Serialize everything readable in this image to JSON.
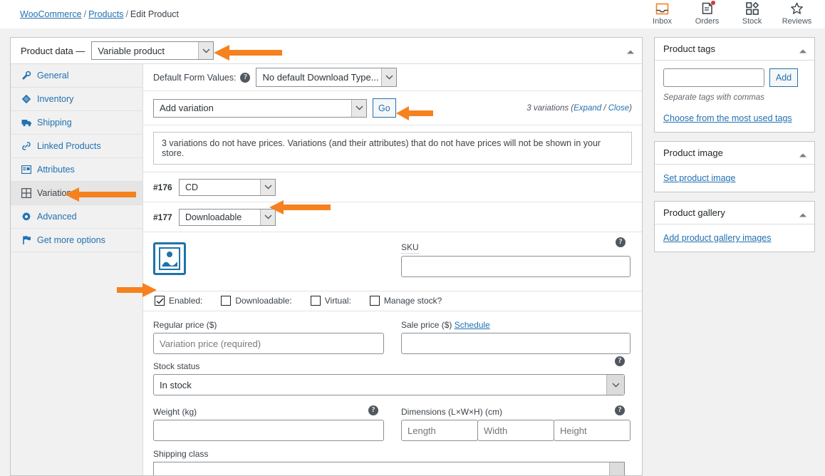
{
  "breadcrumb": {
    "root": "WooCommerce",
    "sep1": "/",
    "products": "Products",
    "sep2": "/",
    "current": "Edit Product"
  },
  "topnav": [
    {
      "label": "Inbox",
      "icon": "inbox-icon",
      "badge": false
    },
    {
      "label": "Orders",
      "icon": "orders-icon",
      "badge": true
    },
    {
      "label": "Stock",
      "icon": "stock-icon",
      "badge": false
    },
    {
      "label": "Reviews",
      "icon": "reviews-star-icon",
      "badge": false
    }
  ],
  "product_data": {
    "title": "Product data —",
    "type_value": "Variable product",
    "collapse_icon": "caret-up-icon",
    "tabs": [
      {
        "label": "General",
        "icon": "wrench-icon",
        "active": false
      },
      {
        "label": "Inventory",
        "icon": "inventory-diamond-icon",
        "active": false
      },
      {
        "label": "Shipping",
        "icon": "truck-icon",
        "active": false
      },
      {
        "label": "Linked Products",
        "icon": "link-icon",
        "active": false
      },
      {
        "label": "Attributes",
        "icon": "attributes-list-icon",
        "active": false
      },
      {
        "label": "Variations",
        "icon": "variations-grid-icon",
        "active": true
      },
      {
        "label": "Advanced",
        "icon": "gear-icon",
        "active": false
      },
      {
        "label": "Get more options",
        "icon": "flag-icon",
        "active": false
      }
    ],
    "default_form_values": {
      "label": "Default Form Values:",
      "help": "?",
      "value": "No default Download Type..."
    },
    "add_variation": {
      "select_value": "Add variation",
      "go_label": "Go",
      "count_text": "3 variations (",
      "expand_label": "Expand",
      "count_sep": " / ",
      "close_label": "Close",
      "count_close": ")"
    },
    "notice": "3 variations do not have prices. Variations (and their attributes) that do not have prices will not be shown in your store.",
    "variations": [
      {
        "id": "#176",
        "value": "CD"
      },
      {
        "id": "#177",
        "value": "Downloadable"
      }
    ],
    "variation_detail": {
      "image_alt": "variation-image-placeholder",
      "sku": {
        "label": "SKU",
        "value": "",
        "help": "?"
      },
      "checkboxes": [
        {
          "label": "Enabled:",
          "checked": true
        },
        {
          "label": "Downloadable:",
          "checked": false
        },
        {
          "label": "Virtual:",
          "checked": false
        },
        {
          "label": "Manage stock?",
          "checked": false
        }
      ],
      "regular_price": {
        "label": "Regular price ($)",
        "placeholder": "Variation price (required)",
        "value": ""
      },
      "sale_price": {
        "label": "Sale price ($)",
        "schedule_link": "Schedule",
        "value": ""
      },
      "stock_status": {
        "label": "Stock status",
        "value": "In stock",
        "help": "?"
      },
      "weight": {
        "label": "Weight (kg)",
        "value": "",
        "help": "?"
      },
      "dimensions": {
        "label": "Dimensions (L×W×H) (cm)",
        "help": "?",
        "length_placeholder": "Length",
        "width_placeholder": "Width",
        "height_placeholder": "Height"
      },
      "shipping_class": {
        "label": "Shipping class",
        "value": ""
      }
    }
  },
  "sidebar": {
    "panels": [
      {
        "title": "Product tags",
        "toggle_icon": "caret-up-icon",
        "input_value": "",
        "add_label": "Add",
        "hint": "Separate tags with commas",
        "link": "Choose from the most used tags"
      },
      {
        "title": "Product image",
        "toggle_icon": "caret-up-icon",
        "link": "Set product image"
      },
      {
        "title": "Product gallery",
        "toggle_icon": "caret-up-icon",
        "link": "Add product gallery images"
      }
    ]
  },
  "colors": {
    "annotation_arrow": "#f5821f",
    "link_blue": "#2271b1",
    "woo_icon_blue": "#1e73aa",
    "badge_red": "#d63638",
    "page_bg": "#f1f1f1"
  }
}
